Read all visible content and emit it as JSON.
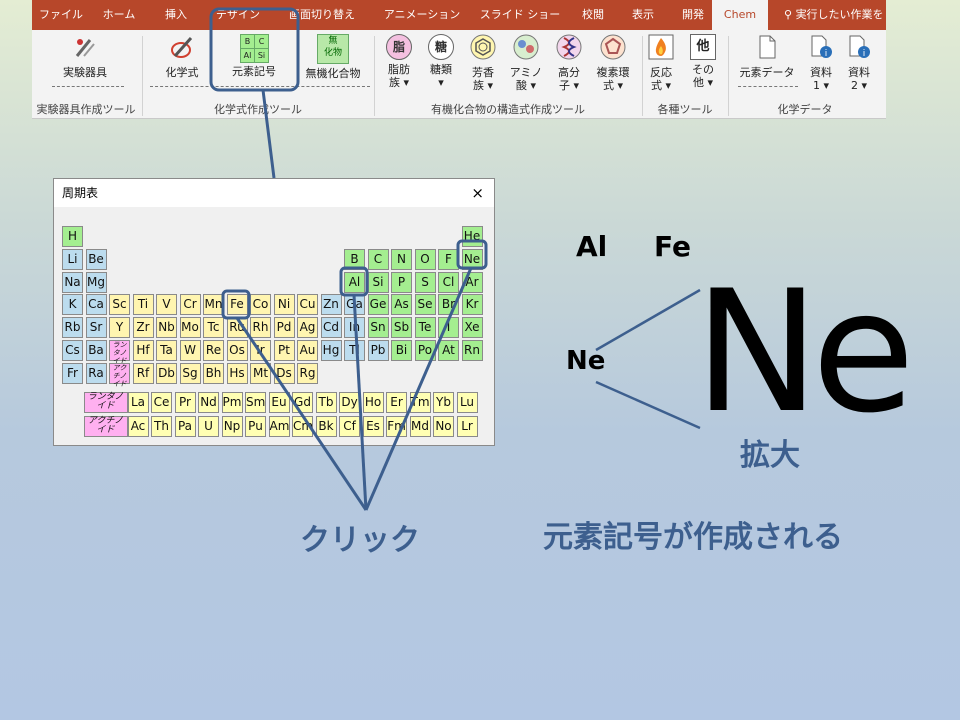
{
  "ribbon": {
    "tabs": [
      "ファイル",
      "ホーム",
      "挿入",
      "デザイン",
      "画面切り替え",
      "アニメーション",
      "スライド ショー",
      "校閲",
      "表示",
      "開発",
      "Chem"
    ],
    "active_tab": "Chem",
    "tell_me": "実行したい作業を",
    "buttons": {
      "jikken": "実験器具",
      "kagakushiki": "化学式",
      "genso": "元素記号",
      "genso_icon": [
        "B",
        "C",
        "Al",
        "Si"
      ],
      "muki": "無機化合物",
      "muki_icon_top": "無",
      "muki_icon_bottom": "化物",
      "shibou": [
        "脂肪",
        "族"
      ],
      "shibou_icon": "脂",
      "torui": [
        "糖類",
        ""
      ],
      "torui_icon": "糖",
      "houko": [
        "芳香",
        "族"
      ],
      "amino": [
        "アミノ",
        "酸"
      ],
      "koubunshi": [
        "高分",
        "子"
      ],
      "fukuso": [
        "複素環",
        "式"
      ],
      "hannou": [
        "反応",
        "式"
      ],
      "sonota": [
        "その",
        "他"
      ],
      "sonota_icon": "他",
      "genso_data": "元素データ",
      "shiryo1": [
        "資料",
        "1"
      ],
      "shiryo2": [
        "資料",
        "2"
      ]
    },
    "groups": {
      "g1": "実験器具作成ツール",
      "g2": "化学式作成ツール",
      "g3": "有機化合物の構造式作成ツール",
      "g4": "各種ツール",
      "g5": "化学データ"
    }
  },
  "dialog": {
    "title": "周期表",
    "close": "×",
    "lanthanoid_label": "ランタノイド",
    "actinoid_label": "アクチノイド",
    "rows": [
      [
        "H",
        "",
        "",
        "",
        "",
        "",
        "",
        "",
        "",
        "",
        "",
        "",
        "",
        "",
        "",
        "",
        "",
        "He"
      ],
      [
        "Li",
        "Be",
        "",
        "",
        "",
        "",
        "",
        "",
        "",
        "",
        "",
        "",
        "B",
        "C",
        "N",
        "O",
        "F",
        "Ne"
      ],
      [
        "Na",
        "Mg",
        "",
        "",
        "",
        "",
        "",
        "",
        "",
        "",
        "",
        "",
        "Al",
        "Si",
        "P",
        "S",
        "Cl",
        "Ar"
      ],
      [
        "K",
        "Ca",
        "Sc",
        "Ti",
        "V",
        "Cr",
        "Mn",
        "Fe",
        "Co",
        "Ni",
        "Cu",
        "Zn",
        "Ga",
        "Ge",
        "As",
        "Se",
        "Br",
        "Kr"
      ],
      [
        "Rb",
        "Sr",
        "Y",
        "Zr",
        "Nb",
        "Mo",
        "Tc",
        "Ru",
        "Rh",
        "Pd",
        "Ag",
        "Cd",
        "In",
        "Sn",
        "Sb",
        "Te",
        "I",
        "Xe"
      ],
      [
        "Cs",
        "Ba",
        "*",
        "Hf",
        "Ta",
        "W",
        "Re",
        "Os",
        "Ir",
        "Pt",
        "Au",
        "Hg",
        "Tl",
        "Pb",
        "Bi",
        "Po",
        "At",
        "Rn"
      ],
      [
        "Fr",
        "Ra",
        "**",
        "Rf",
        "Db",
        "Sg",
        "Bh",
        "Hs",
        "Mt",
        "Ds",
        "Rg",
        "",
        "",
        "",
        "",
        "",
        "",
        ""
      ]
    ],
    "lanthanoids": [
      "La",
      "Ce",
      "Pr",
      "Nd",
      "Pm",
      "Sm",
      "Eu",
      "Gd",
      "Tb",
      "Dy",
      "Ho",
      "Er",
      "Tm",
      "Yb",
      "Lu"
    ],
    "actinoids": [
      "Ac",
      "Th",
      "Pa",
      "U",
      "Np",
      "Pu",
      "Am",
      "Cm",
      "Bk",
      "Cf",
      "Es",
      "Fm",
      "Md",
      "No",
      "Lr"
    ]
  },
  "canvas": {
    "sym_al": "Al",
    "sym_fe": "Fe",
    "sym_ne_small": "Ne",
    "sym_ne_big": "Ne",
    "label_click": "クリック",
    "label_enlarge": "拡大",
    "label_created": "元素記号が作成される"
  },
  "colors": {
    "ribbon_tab_bar": "#b7472a",
    "highlight": "#3d5f8e",
    "s_block": "#bcdcee",
    "p_block": "#a4ee90",
    "d_block": "#fff5b0",
    "f_block": "#ffffb3",
    "series_label": "#ffb0f0"
  }
}
